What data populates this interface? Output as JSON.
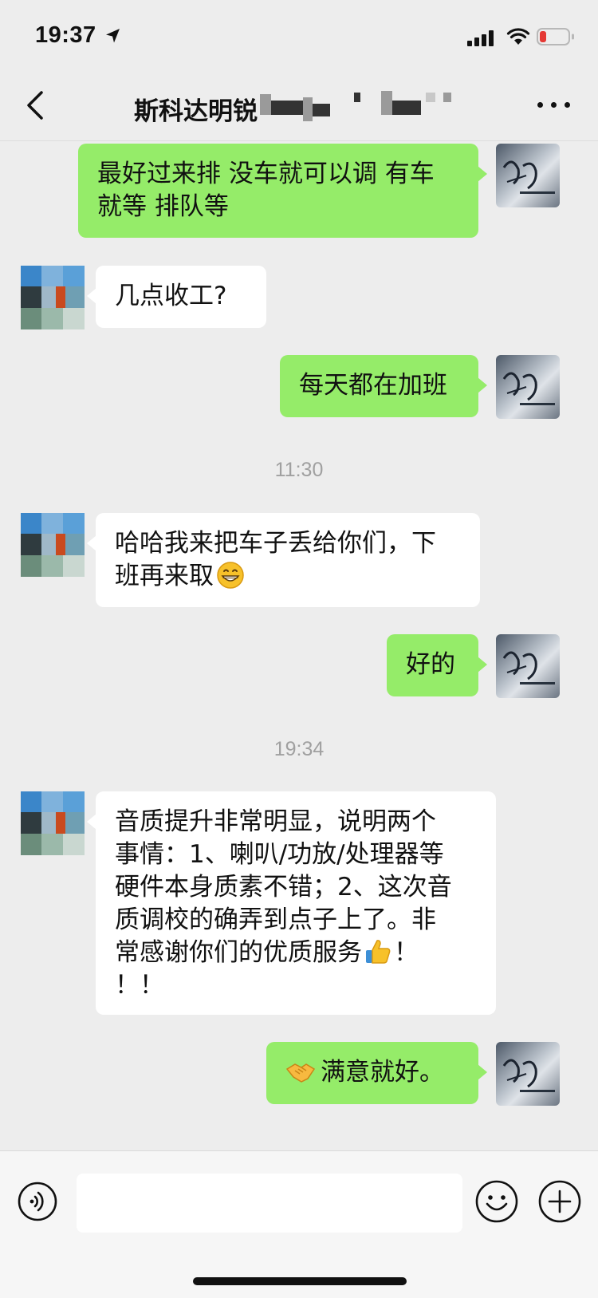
{
  "status_bar": {
    "time": "19:37",
    "battery_level": "low",
    "battery_color": "#e53935"
  },
  "chat": {
    "title": "斯科达明锐"
  },
  "theme": {
    "bubble_me": "#95ec69",
    "bubble_other": "#ffffff",
    "background": "#ededed"
  },
  "messages": [
    {
      "sender": "me",
      "text": "最好过来排 没车就可以调 有车\n就等 排队等"
    },
    {
      "sender": "other",
      "text": "几点收工?"
    },
    {
      "sender": "me",
      "text": "每天都在加班"
    },
    {
      "type": "timestamp",
      "text": "11:30"
    },
    {
      "sender": "other",
      "text": "哈哈我来把车子丢给你们，下\n班再来取",
      "emoji": "grinning-face"
    },
    {
      "sender": "me",
      "text": "好的"
    },
    {
      "type": "timestamp",
      "text": "19:34"
    },
    {
      "sender": "other",
      "text": "音质提升非常明显，说明两个\n事情：1、喇叭/功放/处理器等\n硬件本身质素不错；2、这次音\n质调校的确弄到点子上了。非\n常感谢你们的优质服务",
      "text_after_emoji": "！\n！！",
      "emoji": "thumbs-up"
    },
    {
      "sender": "me",
      "text": "满意就好。",
      "emoji": "handshake"
    }
  ],
  "input_bar": {
    "value": "",
    "placeholder": ""
  }
}
